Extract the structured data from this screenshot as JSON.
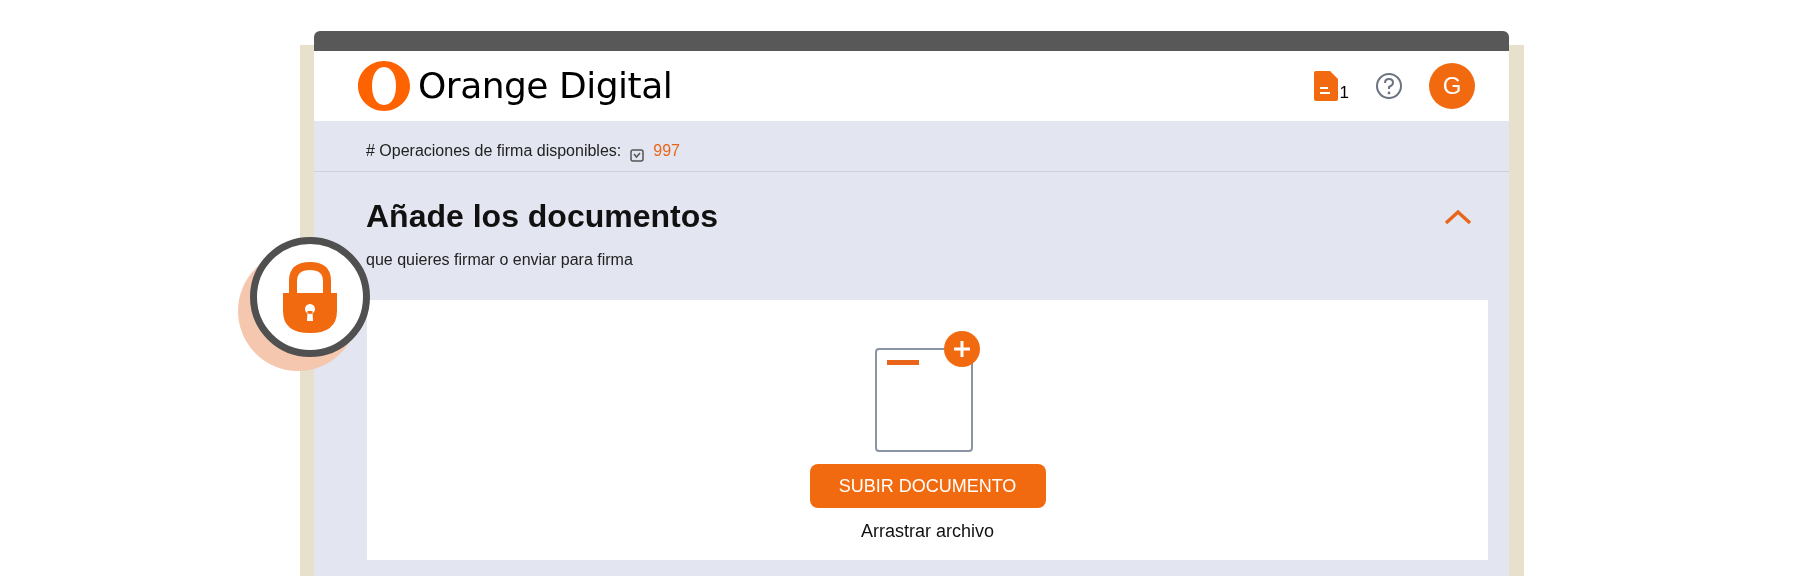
{
  "header": {
    "brand": "Orange Digital",
    "documents_count": "1",
    "avatar_initial": "G"
  },
  "operations": {
    "label": "# Operaciones de firma disponibles:",
    "value": "997"
  },
  "section": {
    "title": "Añade los documentos",
    "subtitle": "que quieres firmar o enviar para firma",
    "expanded": true
  },
  "upload": {
    "button": "SUBIR DOCUMENTO",
    "hint": "Arrastrar archivo"
  }
}
